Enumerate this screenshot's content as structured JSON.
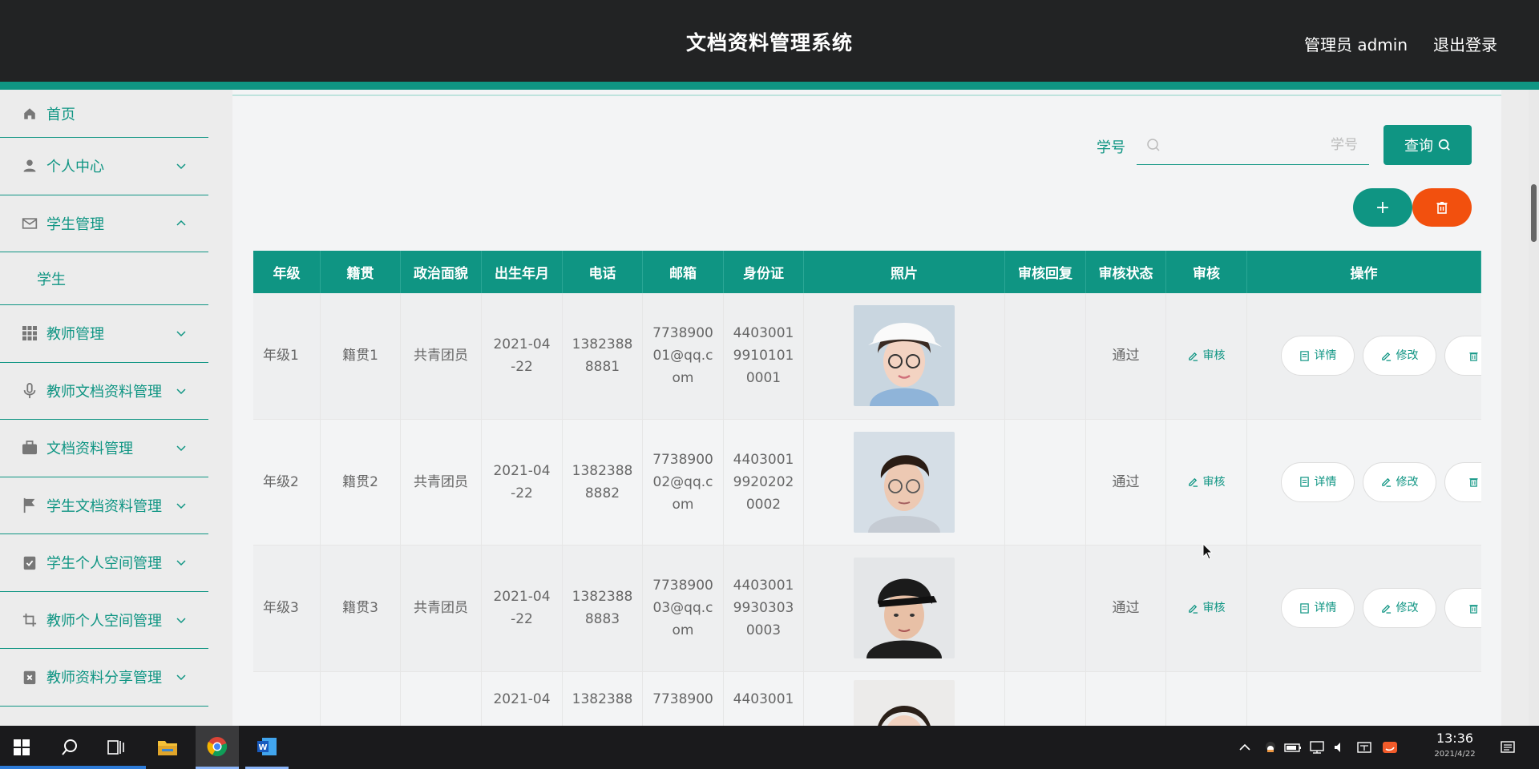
{
  "header": {
    "title": "文档资料管理系统",
    "user_label": "管理员 admin",
    "logout_label": "退出登录"
  },
  "sidebar": {
    "items": [
      {
        "label": "首页",
        "icon": "home-icon"
      },
      {
        "label": "个人中心",
        "icon": "person-icon"
      },
      {
        "label": "学生管理",
        "icon": "mail-icon",
        "expanded": true
      },
      {
        "label": "教师管理",
        "icon": "grid-icon"
      },
      {
        "label": "教师文档资料管理",
        "icon": "microphone-icon"
      },
      {
        "label": "文档资料管理",
        "icon": "briefcase-icon"
      },
      {
        "label": "学生文档资料管理",
        "icon": "flag-icon"
      },
      {
        "label": "学生个人空间管理",
        "icon": "clipboard-check-icon"
      },
      {
        "label": "教师个人空间管理",
        "icon": "crop-icon"
      },
      {
        "label": "教师资料分享管理",
        "icon": "clipboard-x-icon"
      }
    ],
    "sub_item": "学生"
  },
  "search": {
    "label": "学号",
    "placeholder": "学号",
    "query_label": "查询"
  },
  "table": {
    "headers": [
      "年级",
      "籍贯",
      "政治面貌",
      "出生年月",
      "电话",
      "邮箱",
      "身份证",
      "照片",
      "审核回复",
      "审核状态",
      "审核",
      "操作"
    ],
    "rows": [
      {
        "grade": "年级1",
        "origin": "籍贯1",
        "political": "共青团员",
        "birth": "2021-04-22",
        "phone": "13823888881",
        "email": "773890001@qq.com",
        "id_card": "440300199101010001",
        "photo": "female-glasses-cap",
        "reply": "",
        "status": "通过"
      },
      {
        "grade": "年级2",
        "origin": "籍贯2",
        "political": "共青团员",
        "birth": "2021-04-22",
        "phone": "13823888882",
        "email": "773890002@qq.com",
        "id_card": "440300199202020002",
        "photo": "male-glasses",
        "reply": "",
        "status": "通过"
      },
      {
        "grade": "年级3",
        "origin": "籍贯3",
        "political": "共青团员",
        "birth": "2021-04-22",
        "phone": "13823888883",
        "email": "773890003@qq.com",
        "id_card": "440300199303030003",
        "photo": "male-black-cap",
        "reply": "",
        "status": "通过"
      },
      {
        "grade": "",
        "origin": "",
        "political": "",
        "birth": "2021-04",
        "phone": "1382388",
        "email": "7738900",
        "id_card": "4403001",
        "photo": "female-short-hair",
        "reply": "",
        "status": ""
      }
    ],
    "review_label": "审核",
    "actions": {
      "detail": "详情",
      "edit": "修改",
      "delete": "删"
    }
  },
  "taskbar": {
    "time": "13:36",
    "date": "2021/4/22",
    "apps": [
      "windows-start-icon",
      "search-icon",
      "task-view-icon",
      "file-explorer-icon",
      "chrome-icon",
      "word-icon"
    ]
  },
  "colors": {
    "primary": "#0f9583",
    "danger": "#f2500e",
    "header_bg": "#222324"
  }
}
